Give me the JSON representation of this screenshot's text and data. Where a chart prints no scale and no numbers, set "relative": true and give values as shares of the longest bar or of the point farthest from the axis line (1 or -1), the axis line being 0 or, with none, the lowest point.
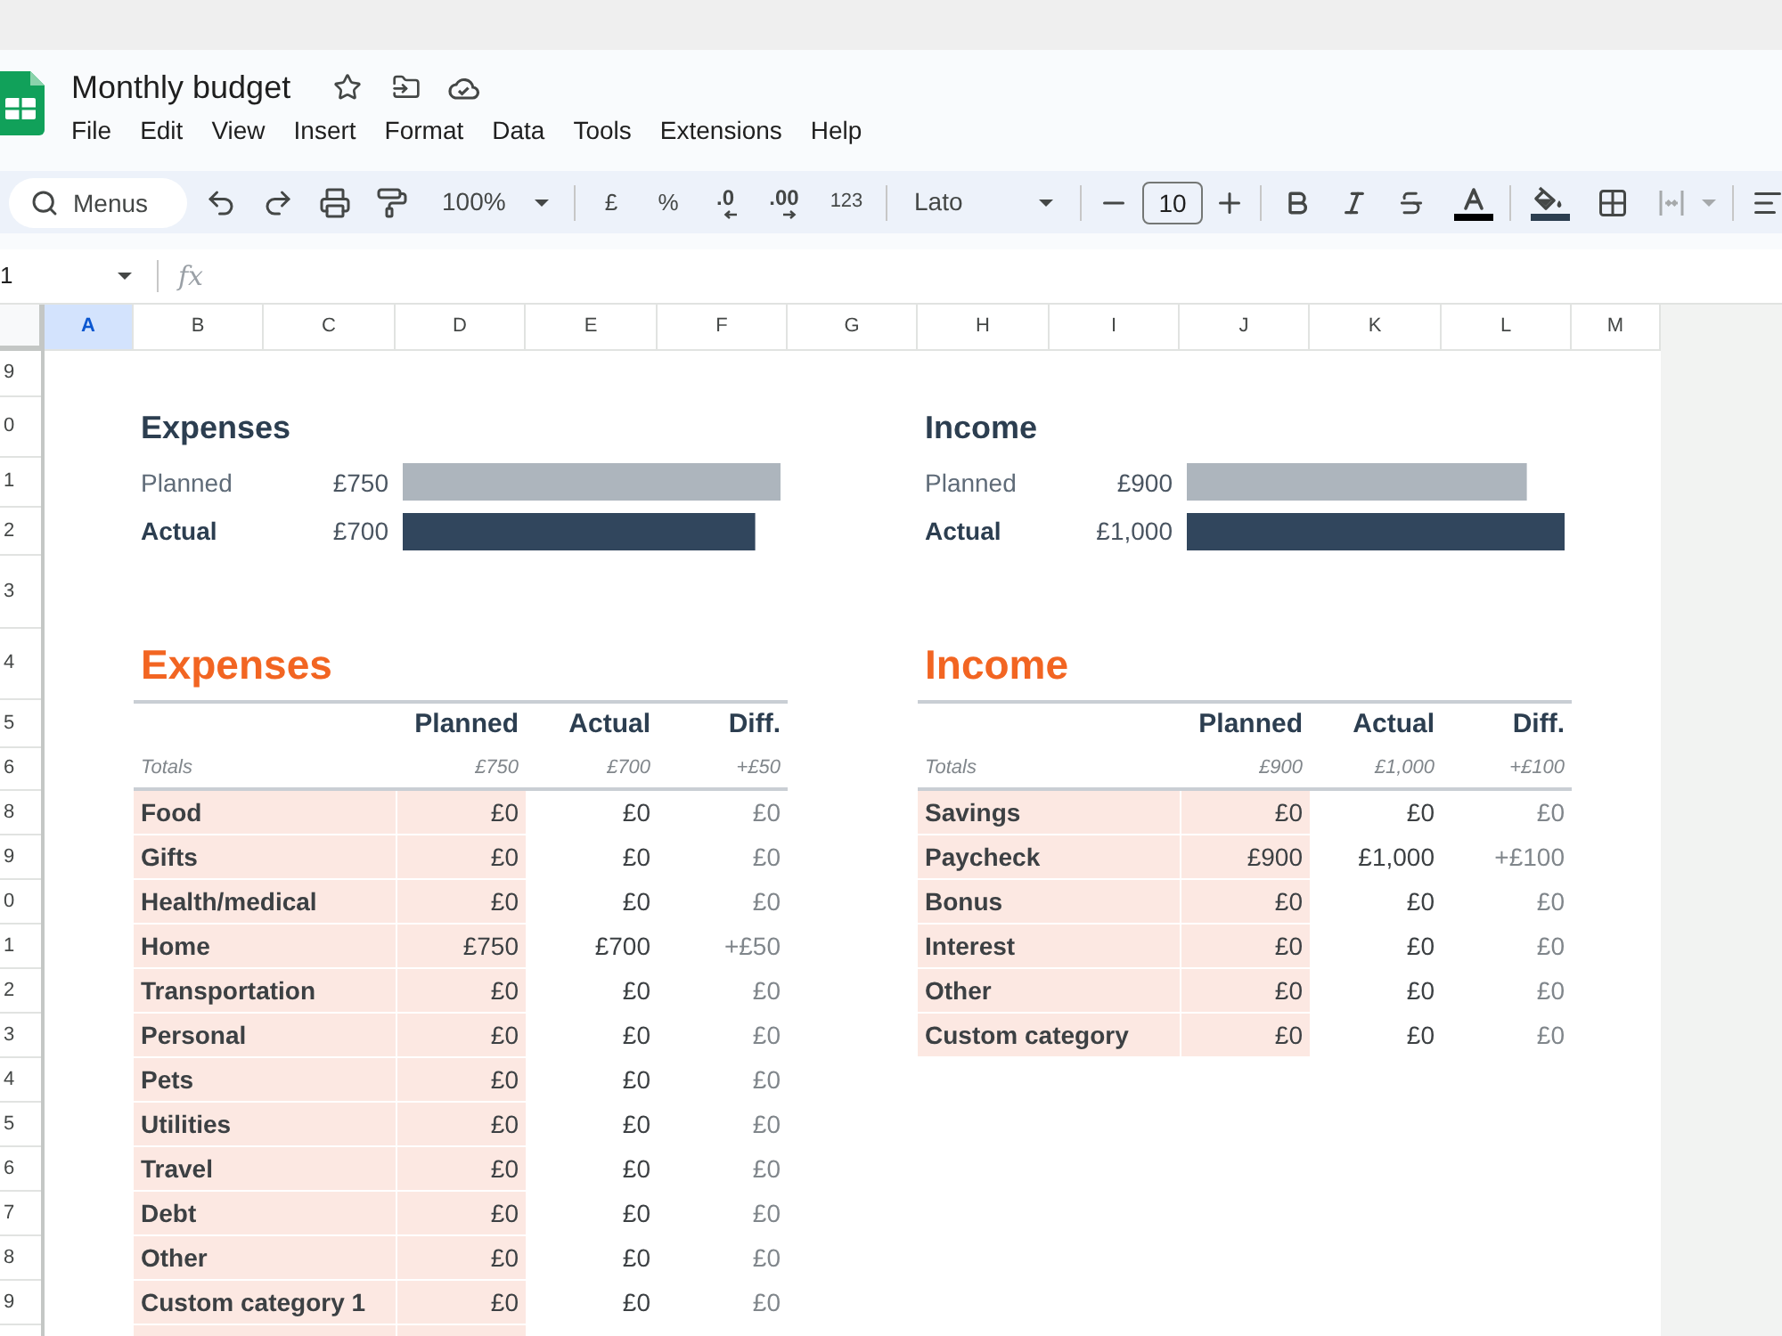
{
  "document": {
    "title": "Monthly budget"
  },
  "menu": [
    "File",
    "Edit",
    "View",
    "Insert",
    "Format",
    "Data",
    "Tools",
    "Extensions",
    "Help"
  ],
  "toolbar": {
    "search": {
      "placeholder": "Menus"
    },
    "zoom": "100%",
    "currency": "£",
    "percent": "%",
    "decrease_decimal": ".0",
    "increase_decimal": ".00",
    "number_format": "123",
    "font": "Lato",
    "font_size": "10"
  },
  "formula_bar": {
    "name_box": "1",
    "function_label": "fx"
  },
  "columns": [
    {
      "label": "A",
      "selected": true
    },
    {
      "label": "B",
      "selected": false
    },
    {
      "label": "C",
      "selected": false
    },
    {
      "label": "D",
      "selected": false
    },
    {
      "label": "E",
      "selected": false
    },
    {
      "label": "F",
      "selected": false
    },
    {
      "label": "G",
      "selected": false
    },
    {
      "label": "H",
      "selected": false
    },
    {
      "label": "I",
      "selected": false
    },
    {
      "label": "J",
      "selected": false
    },
    {
      "label": "K",
      "selected": false
    },
    {
      "label": "L",
      "selected": false
    },
    {
      "label": "M",
      "selected": false
    }
  ],
  "rows": [
    "9",
    "0",
    "1",
    "2",
    "3",
    "4",
    "5",
    "6",
    "8",
    "9",
    "0",
    "1",
    "2",
    "3",
    "4",
    "5",
    "6",
    "7",
    "8",
    "9"
  ],
  "summaries": [
    {
      "title": "Expenses",
      "chart_data": {
        "type": "bar",
        "orientation": "horizontal",
        "relative": true,
        "stacked": true,
        "categories": [
          "Planned",
          "Actual"
        ],
        "series": [
          {
            "color": "#adb5bd",
            "values": [
              1,
              null
            ]
          },
          {
            "color": "#31465d",
            "values": [
              null,
              0.933
            ]
          }
        ],
        "value_labels": [
          "£750",
          "£700"
        ]
      }
    },
    {
      "title": "Income",
      "chart_data": {
        "type": "bar",
        "orientation": "horizontal",
        "relative": true,
        "stacked": true,
        "categories": [
          "Planned",
          "Actual"
        ],
        "series": [
          {
            "color": "#adb5bd",
            "values": [
              0.9,
              null
            ]
          },
          {
            "color": "#31465d",
            "values": [
              null,
              1
            ]
          }
        ],
        "value_labels": [
          "£900",
          "£1,000"
        ]
      }
    }
  ],
  "tables": [
    {
      "title": "Expenses",
      "columns": [
        "Planned",
        "Actual",
        "Diff."
      ],
      "totals": {
        "label": "Totals",
        "values": [
          "£750",
          "£700",
          "+£50"
        ]
      },
      "rows": [
        {
          "category": "Food",
          "values": [
            "£0",
            "£0",
            "£0"
          ]
        },
        {
          "category": "Gifts",
          "values": [
            "£0",
            "£0",
            "£0"
          ]
        },
        {
          "category": "Health/medical",
          "values": [
            "£0",
            "£0",
            "£0"
          ]
        },
        {
          "category": "Home",
          "values": [
            "£750",
            "£700",
            "+£50"
          ]
        },
        {
          "category": "Transportation",
          "values": [
            "£0",
            "£0",
            "£0"
          ]
        },
        {
          "category": "Personal",
          "values": [
            "£0",
            "£0",
            "£0"
          ]
        },
        {
          "category": "Pets",
          "values": [
            "£0",
            "£0",
            "£0"
          ]
        },
        {
          "category": "Utilities",
          "values": [
            "£0",
            "£0",
            "£0"
          ]
        },
        {
          "category": "Travel",
          "values": [
            "£0",
            "£0",
            "£0"
          ]
        },
        {
          "category": "Debt",
          "values": [
            "£0",
            "£0",
            "£0"
          ]
        },
        {
          "category": "Other",
          "values": [
            "£0",
            "£0",
            "£0"
          ]
        },
        {
          "category": "Custom category 1",
          "values": [
            "£0",
            "£0",
            "£0"
          ]
        }
      ],
      "partial_row": true
    },
    {
      "title": "Income",
      "columns": [
        "Planned",
        "Actual",
        "Diff."
      ],
      "totals": {
        "label": "Totals",
        "values": [
          "£900",
          "£1,000",
          "+£100"
        ]
      },
      "rows": [
        {
          "category": "Savings",
          "values": [
            "£0",
            "£0",
            "£0"
          ]
        },
        {
          "category": "Paycheck",
          "values": [
            "£900",
            "£1,000",
            "+£100"
          ]
        },
        {
          "category": "Bonus",
          "values": [
            "£0",
            "£0",
            "£0"
          ]
        },
        {
          "category": "Interest",
          "values": [
            "£0",
            "£0",
            "£0"
          ]
        },
        {
          "category": "Other",
          "values": [
            "£0",
            "£0",
            "£0"
          ]
        },
        {
          "category": "Custom category",
          "values": [
            "£0",
            "£0",
            "£0"
          ]
        }
      ],
      "partial_row": false
    }
  ]
}
